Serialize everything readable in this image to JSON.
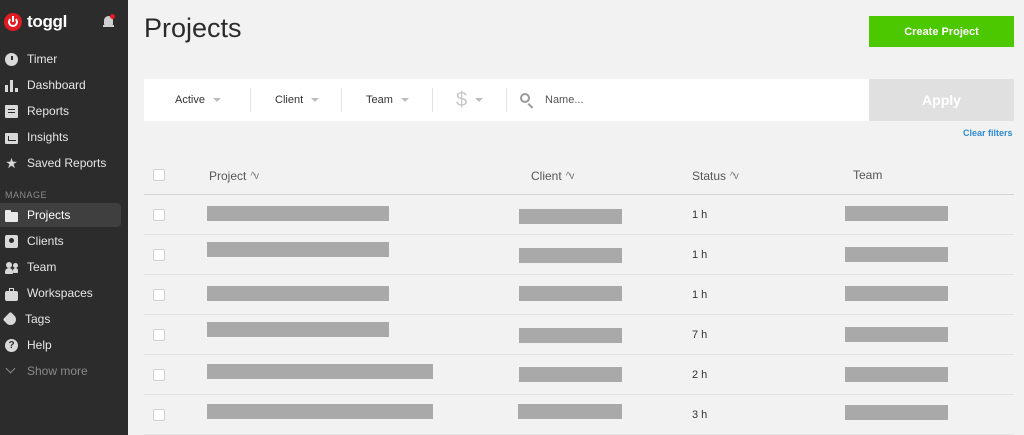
{
  "app": {
    "brand": "toggl"
  },
  "sidebar": {
    "items": [
      {
        "label": "Timer",
        "icon": "clock-icon"
      },
      {
        "label": "Dashboard",
        "icon": "bar-chart-icon"
      },
      {
        "label": "Reports",
        "icon": "document-icon"
      },
      {
        "label": "Insights",
        "icon": "insights-icon"
      },
      {
        "label": "Saved Reports",
        "icon": "star-icon"
      }
    ],
    "section_label": "MANAGE",
    "manage_items": [
      {
        "label": "Projects",
        "icon": "folder-icon",
        "active": true
      },
      {
        "label": "Clients",
        "icon": "contact-icon"
      },
      {
        "label": "Team",
        "icon": "team-icon"
      },
      {
        "label": "Workspaces",
        "icon": "briefcase-icon"
      },
      {
        "label": "Tags",
        "icon": "tag-icon"
      },
      {
        "label": "Help",
        "icon": "help-icon"
      }
    ],
    "show_more": "Show more"
  },
  "header": {
    "title": "Projects",
    "create_label": "Create Project"
  },
  "filters": {
    "status": "Active",
    "client": "Client",
    "team": "Team",
    "billable": "$",
    "search_placeholder": "Name...",
    "apply_label": "Apply",
    "clear_label": "Clear filters"
  },
  "table": {
    "columns": {
      "project": "Project",
      "client": "Client",
      "status": "Status",
      "team": "Team"
    },
    "sort_glyph": "^v",
    "rows": [
      {
        "status": "1 h"
      },
      {
        "status": "1 h"
      },
      {
        "status": "1 h"
      },
      {
        "status": "7 h"
      },
      {
        "status": "2 h"
      },
      {
        "status": "3 h"
      }
    ]
  },
  "colors": {
    "sidebar_bg": "#2c2c2c",
    "accent_green": "#4bc800",
    "brand_red": "#e01b22",
    "link_blue": "#2d8bd2",
    "redaction_gray": "#a9a9a9"
  }
}
